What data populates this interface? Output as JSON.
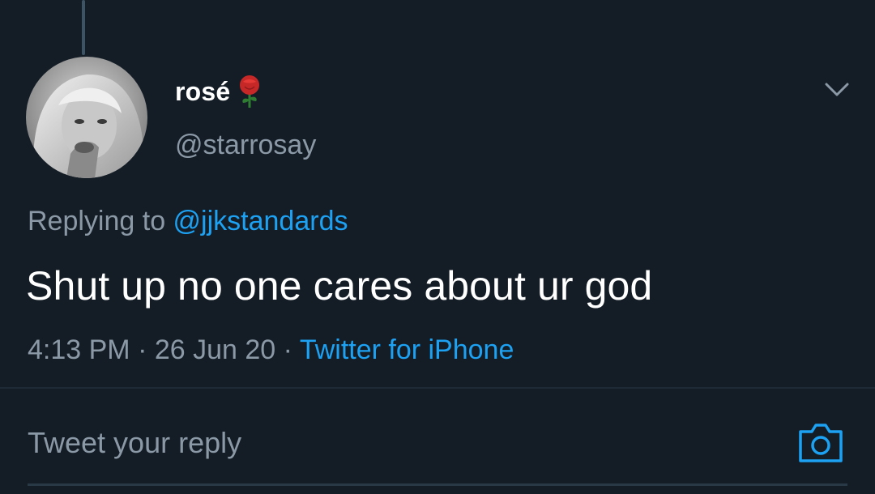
{
  "tweet": {
    "display_name": "rosé",
    "name_emoji_icon": "rose-icon",
    "handle": "@starrosay",
    "replying_prefix": "Replying to ",
    "replying_to": "@jjkstandards",
    "text": "Shut up no one cares about ur god",
    "time": "4:13 PM",
    "date": "26 Jun 20",
    "separator": " · ",
    "source": "Twitter for iPhone"
  },
  "reply_composer": {
    "placeholder": "Tweet your reply",
    "camera_icon": "camera-icon"
  },
  "icons": {
    "more_menu": "chevron-down-icon"
  },
  "colors": {
    "background": "#141d26",
    "text_primary": "#ffffff",
    "text_secondary": "#8b99a6",
    "accent": "#1da1f2"
  }
}
